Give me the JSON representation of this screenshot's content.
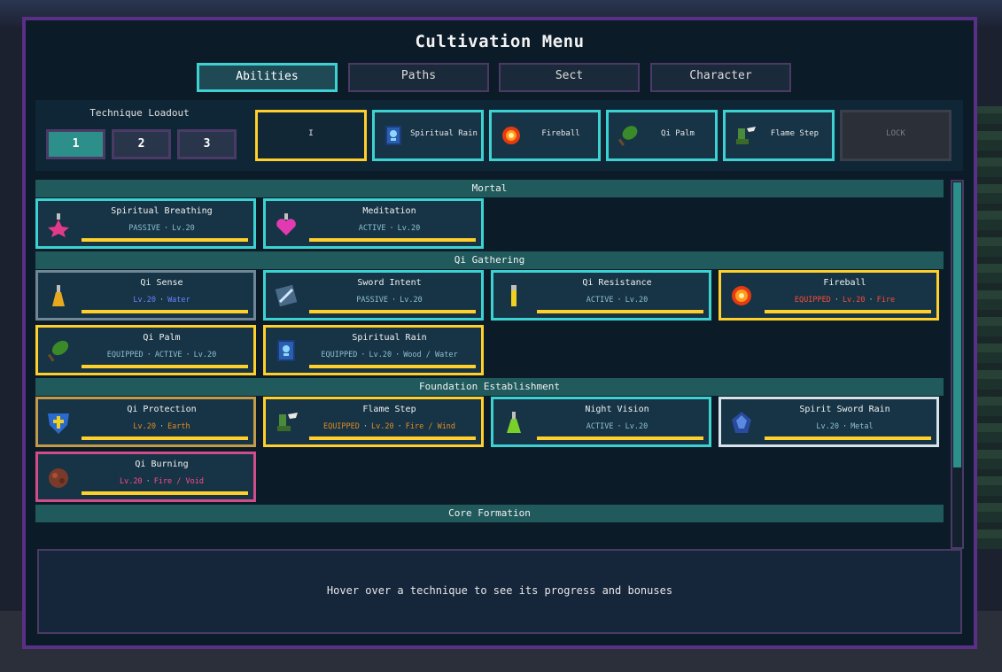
{
  "title": "Cultivation Menu",
  "tabs": [
    {
      "label": "Abilities",
      "active": true
    },
    {
      "label": "Paths",
      "active": false
    },
    {
      "label": "Sect",
      "active": false
    },
    {
      "label": "Character",
      "active": false
    }
  ],
  "loadout": {
    "title": "Technique Loadout",
    "presets": [
      "1",
      "2",
      "3"
    ],
    "active_preset": "1",
    "slots": [
      {
        "label": "I",
        "icon": "empty-slot",
        "selected": true
      },
      {
        "label": "Spiritual Rain",
        "icon": "spellbook-icon"
      },
      {
        "label": "Fireball",
        "icon": "fireball-icon"
      },
      {
        "label": "Qi Palm",
        "icon": "leaf-fan-icon"
      },
      {
        "label": "Flame Step",
        "icon": "winged-boot-icon"
      },
      {
        "label": "LOCK",
        "icon": "lock",
        "locked": true
      }
    ]
  },
  "sections": [
    {
      "name": "Mortal",
      "cards": [
        {
          "name": "Spiritual Breathing",
          "icon": "star-potion-icon",
          "tags": [
            "PASSIVE",
            "Lv.20"
          ]
        },
        {
          "name": "Meditation",
          "icon": "heart-potion-icon",
          "tags": [
            "ACTIVE",
            "Lv.20"
          ]
        }
      ]
    },
    {
      "name": "Qi Gathering",
      "cards": [
        {
          "name": "Qi Sense",
          "icon": "gold-flask-icon",
          "tags": [
            "Lv.20",
            "Water"
          ]
        },
        {
          "name": "Sword Intent",
          "icon": "sword-tome-icon",
          "tags": [
            "PASSIVE",
            "Lv.20"
          ]
        },
        {
          "name": "Qi Resistance",
          "icon": "vial-icon",
          "tags": [
            "ACTIVE",
            "Lv.20"
          ]
        },
        {
          "name": "Fireball",
          "icon": "fireball-icon",
          "tags": [
            "EQUIPPED",
            "Lv.20",
            "Fire"
          ]
        },
        {
          "name": "Qi Palm",
          "icon": "leaf-fan-icon",
          "tags": [
            "EQUIPPED",
            "ACTIVE",
            "Lv.20"
          ]
        },
        {
          "name": "Spiritual Rain",
          "icon": "spellbook-icon",
          "tags": [
            "EQUIPPED",
            "Lv.20",
            "Wood / Water"
          ]
        }
      ]
    },
    {
      "name": "Foundation Establishment",
      "cards": [
        {
          "name": "Qi Protection",
          "icon": "cross-shield-icon",
          "tags": [
            "Lv.20",
            "Earth"
          ]
        },
        {
          "name": "Flame Step",
          "icon": "winged-boot-icon",
          "tags": [
            "EQUIPPED",
            "Lv.20",
            "Fire / Wind"
          ]
        },
        {
          "name": "Night Vision",
          "icon": "green-flask-icon",
          "tags": [
            "ACTIVE",
            "Lv.20"
          ]
        },
        {
          "name": "Spirit Sword Rain",
          "icon": "crystal-orb-icon",
          "tags": [
            "Lv.20",
            "Metal"
          ]
        },
        {
          "name": "Qi Burning",
          "icon": "ember-stone-icon",
          "tags": [
            "Lv.20",
            "Fire / Void"
          ]
        }
      ]
    },
    {
      "name": "Core Formation",
      "cards": []
    }
  ],
  "info_text": "Hover over a technique to see its progress and bonuses",
  "colors": {
    "frame": "#5a2f86",
    "accent_cyan": "#3dd2d2",
    "equipped_yellow": "#ffd02b",
    "header_teal": "#215a5c"
  }
}
